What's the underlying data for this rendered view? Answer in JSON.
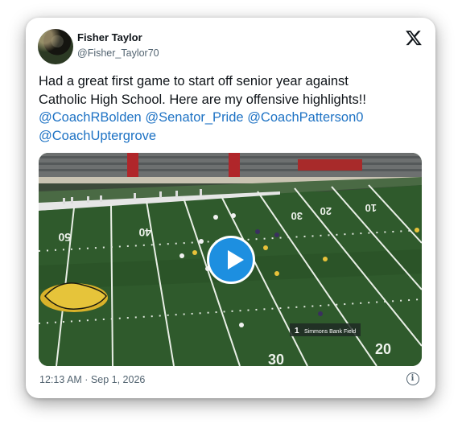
{
  "tweet": {
    "author_name": "Fisher Taylor",
    "author_handle": "@Fisher_Taylor70",
    "text_line1": "Had a great first game to start off senior year against",
    "text_line2": "Catholic High School. Here are my offensive highlights!!",
    "mentions": [
      "@CoachRBolden",
      "@Senator_Pride",
      "@CoachPatterson0",
      "@CoachUptergrove"
    ],
    "timestamp": "12:13 AM · Sep 1, 2026"
  },
  "media": {
    "type": "video",
    "yard_numbers": [
      "50",
      "40",
      "30",
      "20",
      "10",
      "30",
      "20"
    ],
    "sponsor_text": "Simmons Bank Field",
    "sponsor_number": "1"
  },
  "icons": {
    "x_logo": "x-logo-icon",
    "play": "play-icon",
    "info": "info-icon",
    "info_glyph": "i"
  },
  "colors": {
    "mention": "#1d72c4",
    "play_button": "#1d8fe0",
    "field": "#2f5a2c"
  }
}
